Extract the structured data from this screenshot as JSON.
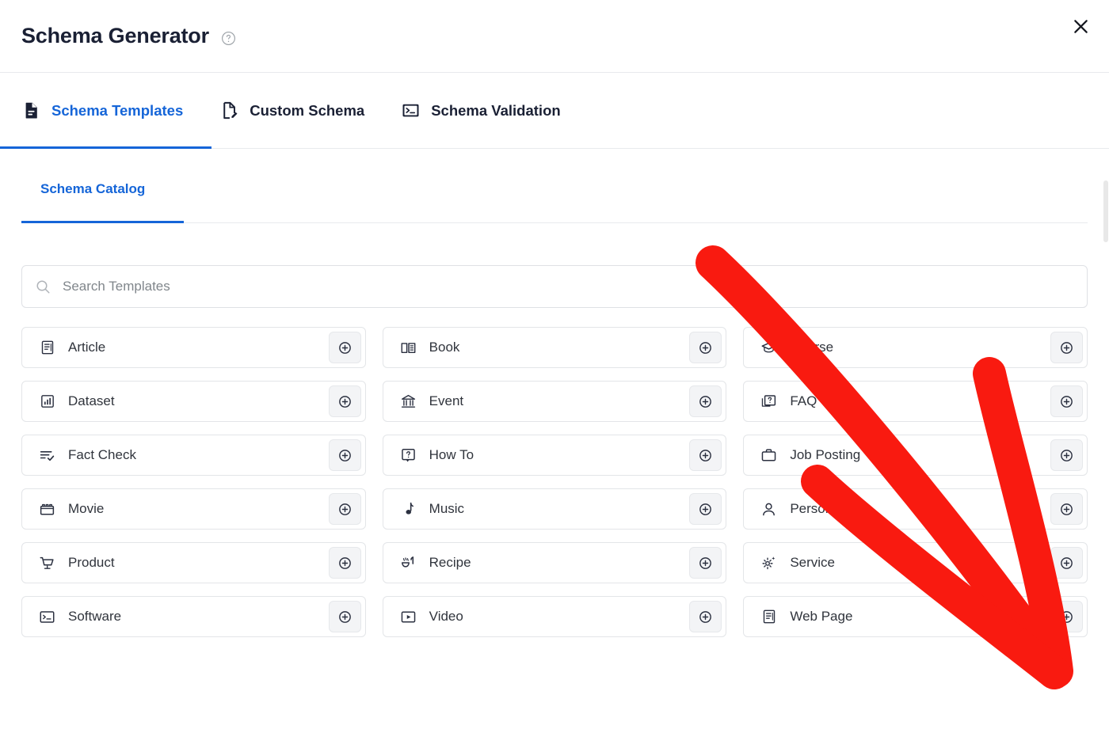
{
  "header": {
    "title": "Schema Generator",
    "help_icon": "question-circle-icon",
    "close_icon": "close-icon"
  },
  "tabs": [
    {
      "label": "Schema Templates",
      "icon": "document-lines-icon",
      "active": true
    },
    {
      "label": "Custom Schema",
      "icon": "document-pencil-icon",
      "active": false
    },
    {
      "label": "Schema Validation",
      "icon": "terminal-icon",
      "active": false
    }
  ],
  "subtabs": [
    {
      "label": "Schema Catalog",
      "active": true
    }
  ],
  "search": {
    "placeholder": "Search Templates",
    "value": "",
    "icon": "search-icon"
  },
  "templates": [
    {
      "label": "Article",
      "icon": "article-icon",
      "add_label": "+"
    },
    {
      "label": "Book",
      "icon": "book-icon",
      "add_label": "+"
    },
    {
      "label": "Course",
      "icon": "graduation-cap-icon",
      "add_label": "+"
    },
    {
      "label": "Dataset",
      "icon": "chart-box-icon",
      "add_label": "+"
    },
    {
      "label": "Event",
      "icon": "landmark-icon",
      "add_label": "+"
    },
    {
      "label": "FAQ",
      "icon": "question-card-icon",
      "add_label": "+"
    },
    {
      "label": "Fact Check",
      "icon": "list-check-icon",
      "add_label": "+"
    },
    {
      "label": "How To",
      "icon": "question-bubble-icon",
      "add_label": "+"
    },
    {
      "label": "Job Posting",
      "icon": "briefcase-icon",
      "add_label": "+"
    },
    {
      "label": "Movie",
      "icon": "clapperboard-icon",
      "add_label": "+"
    },
    {
      "label": "Music",
      "icon": "music-note-icon",
      "add_label": "+"
    },
    {
      "label": "Person",
      "icon": "person-icon",
      "add_label": "+"
    },
    {
      "label": "Product",
      "icon": "shopping-cart-icon",
      "add_label": "+"
    },
    {
      "label": "Recipe",
      "icon": "recipe-icon",
      "add_label": "+"
    },
    {
      "label": "Service",
      "icon": "gear-sparkle-icon",
      "add_label": "+"
    },
    {
      "label": "Software",
      "icon": "terminal-window-icon",
      "add_label": "+"
    },
    {
      "label": "Video",
      "icon": "play-box-icon",
      "add_label": "+"
    },
    {
      "label": "Web Page",
      "icon": "web-page-icon",
      "add_label": "+"
    }
  ],
  "annotation": {
    "type": "arrow",
    "color": "#F91A10",
    "direction": "down-right",
    "points_at": "Web Page add button"
  },
  "colors": {
    "accent_blue": "#1565D8",
    "text_dark": "#1A2034",
    "text_body": "#30343C",
    "placeholder": "#80868B",
    "border": "#E3E5E8",
    "annotation_red": "#F91A10"
  }
}
